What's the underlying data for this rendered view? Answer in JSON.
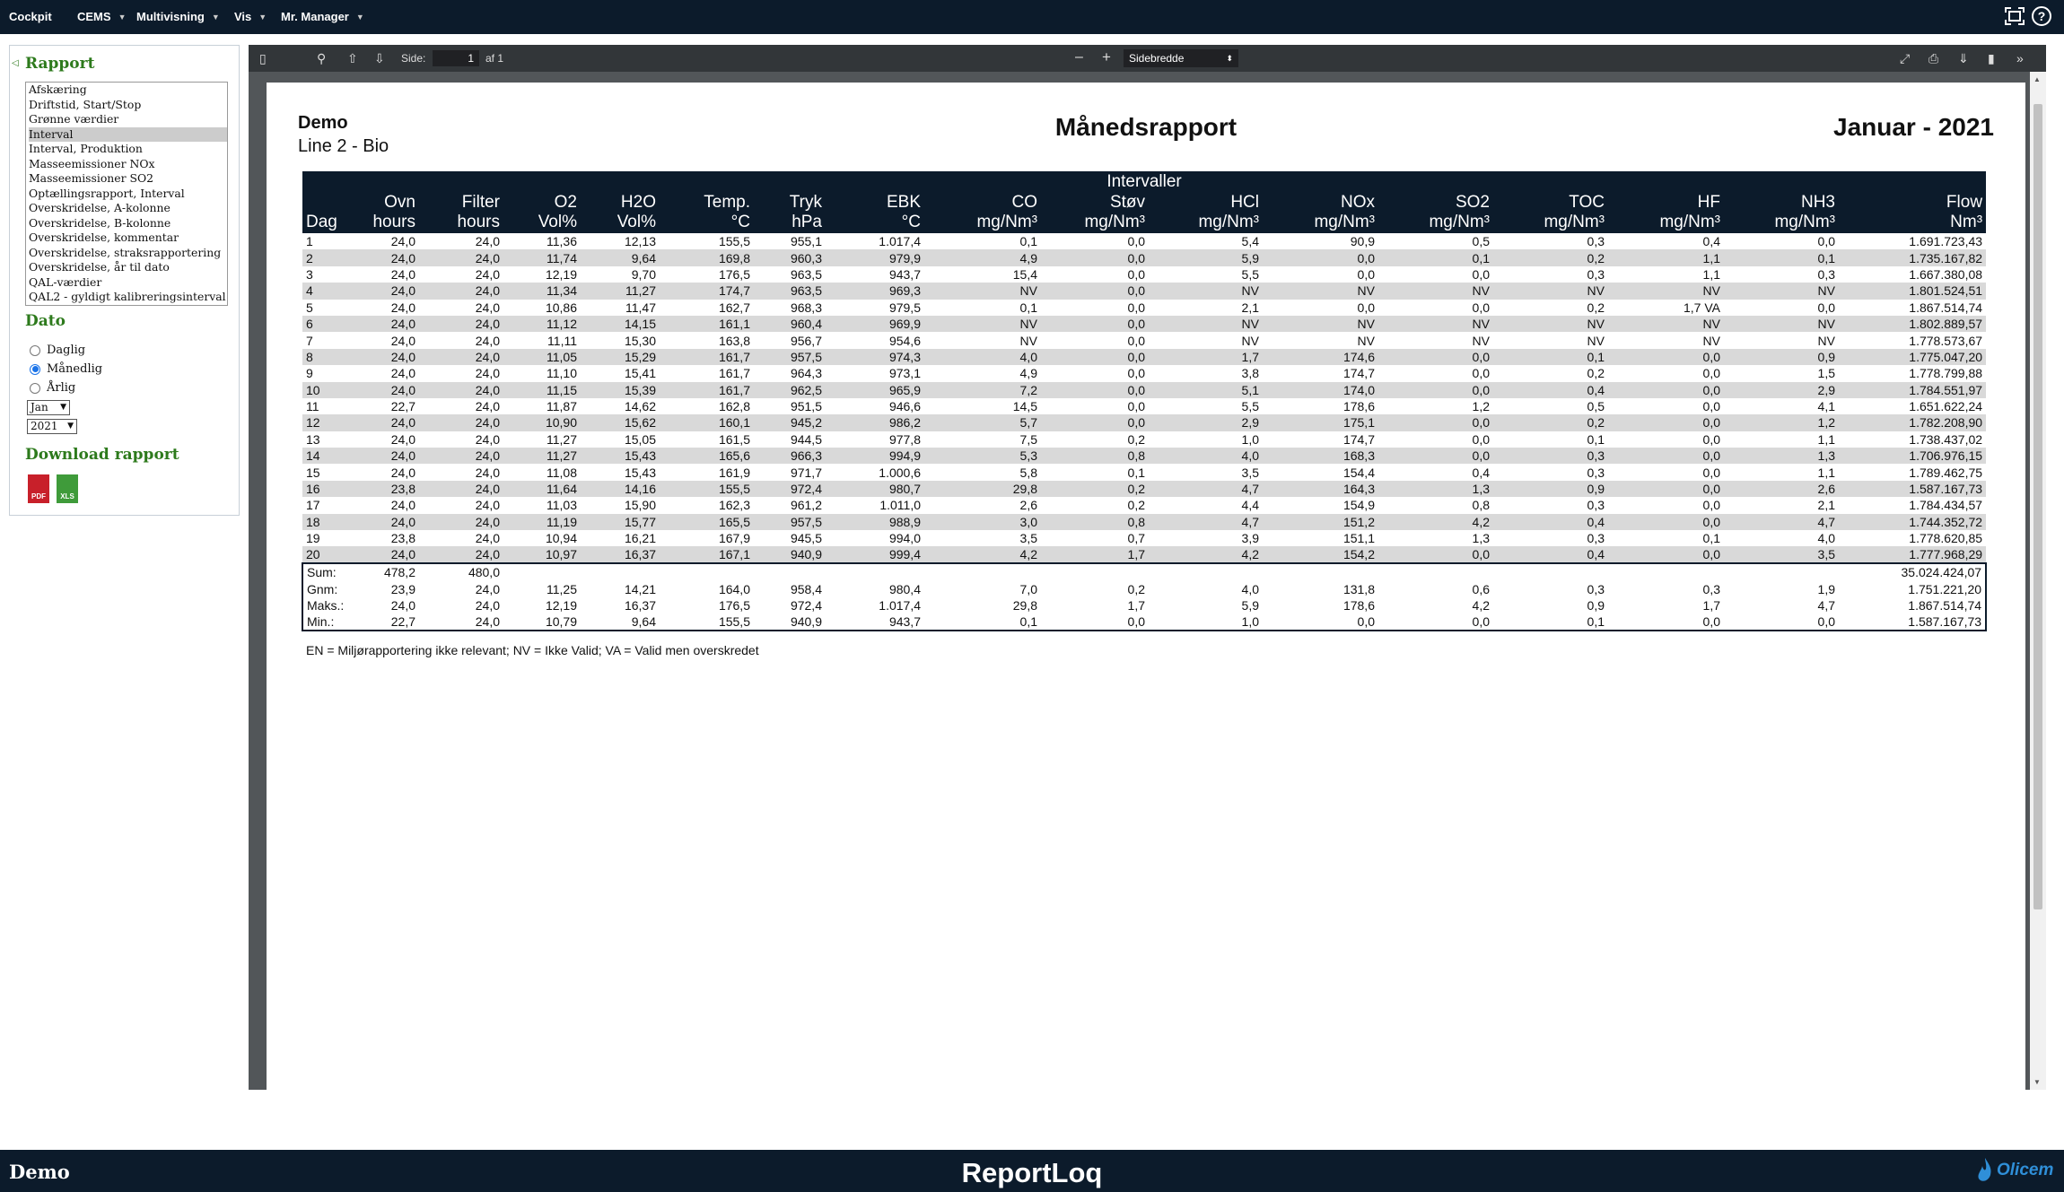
{
  "topbar": {
    "menu": [
      "Cockpit",
      "CEMS",
      "Multivisning",
      "Vis",
      "Mr. Manager"
    ],
    "fullscreen_icon": "fullscreen-icon",
    "help_icon": "help-icon"
  },
  "sidebar": {
    "rapport_title": "Rapport",
    "reports": [
      "Afskæring",
      "Driftstid, Start/Stop",
      "Grønne værdier",
      "Interval",
      "Interval, Produktion",
      "Masseemissioner NOx",
      "Masseemissioner SO2",
      "Optællingsrapport, Interval",
      "Overskridelse, A-kolonne",
      "Overskridelse, B-kolonne",
      "Overskridelse, kommentar",
      "Overskridelse, straksrapportering",
      "Overskridelse, år til dato",
      "QAL-værdier",
      "QAL2 - gyldigt kalibreringsinterval"
    ],
    "selected_report": "Interval",
    "dato_title": "Dato",
    "periods": [
      "Daglig",
      "Månedlig",
      "Årlig"
    ],
    "selected_period": "Månedlig",
    "month": "Jan",
    "year": "2021",
    "download_title": "Download rapport",
    "pdf_label": "PDF",
    "xls_label": "XLS"
  },
  "viewer": {
    "page_label": "Side:",
    "page_value": "1",
    "page_of": "af 1",
    "zoom_out": "–",
    "zoom_in": "+",
    "zoom_mode": "Sidebredde"
  },
  "report": {
    "company": "Demo",
    "line": "Line 2 - Bio",
    "title": "Månedsrapport",
    "period": "Januar - 2021",
    "group_header": "Intervaller",
    "columns": [
      {
        "name": "Dag",
        "unit": ""
      },
      {
        "name": "Ovn",
        "unit": "hours"
      },
      {
        "name": "Filter",
        "unit": "hours"
      },
      {
        "name": "O2",
        "unit": "Vol%"
      },
      {
        "name": "H2O",
        "unit": "Vol%"
      },
      {
        "name": "Temp.",
        "unit": "°C"
      },
      {
        "name": "Tryk",
        "unit": "hPa"
      },
      {
        "name": "EBK",
        "unit": "°C"
      },
      {
        "name": "CO",
        "unit": "mg/Nm³"
      },
      {
        "name": "Støv",
        "unit": "mg/Nm³"
      },
      {
        "name": "HCl",
        "unit": "mg/Nm³"
      },
      {
        "name": "NOx",
        "unit": "mg/Nm³"
      },
      {
        "name": "SO2",
        "unit": "mg/Nm³"
      },
      {
        "name": "TOC",
        "unit": "mg/Nm³"
      },
      {
        "name": "HF",
        "unit": "mg/Nm³"
      },
      {
        "name": "NH3",
        "unit": "mg/Nm³"
      },
      {
        "name": "Flow",
        "unit": "Nm³"
      }
    ],
    "rows": [
      [
        "1",
        "24,0",
        "24,0",
        "11,36",
        "12,13",
        "155,5",
        "955,1",
        "1.017,4",
        "0,1",
        "0,0",
        "5,4",
        "90,9",
        "0,5",
        "0,3",
        "0,4",
        "0,0",
        "1.691.723,43"
      ],
      [
        "2",
        "24,0",
        "24,0",
        "11,74",
        "9,64",
        "169,8",
        "960,3",
        "979,9",
        "4,9",
        "0,0",
        "5,9",
        "0,0",
        "0,1",
        "0,2",
        "1,1",
        "0,1",
        "1.735.167,82"
      ],
      [
        "3",
        "24,0",
        "24,0",
        "12,19",
        "9,70",
        "176,5",
        "963,5",
        "943,7",
        "15,4",
        "0,0",
        "5,5",
        "0,0",
        "0,0",
        "0,3",
        "1,1",
        "0,3",
        "1.667.380,08"
      ],
      [
        "4",
        "24,0",
        "24,0",
        "11,34",
        "11,27",
        "174,7",
        "963,5",
        "969,3",
        "NV",
        "0,0",
        "NV",
        "NV",
        "NV",
        "NV",
        "NV",
        "NV",
        "1.801.524,51"
      ],
      [
        "5",
        "24,0",
        "24,0",
        "10,86",
        "11,47",
        "162,7",
        "968,3",
        "979,5",
        "0,1",
        "0,0",
        "2,1",
        "0,0",
        "0,0",
        "0,2",
        "1,7 VA",
        "0,0",
        "1.867.514,74"
      ],
      [
        "6",
        "24,0",
        "24,0",
        "11,12",
        "14,15",
        "161,1",
        "960,4",
        "969,9",
        "NV",
        "0,0",
        "NV",
        "NV",
        "NV",
        "NV",
        "NV",
        "NV",
        "1.802.889,57"
      ],
      [
        "7",
        "24,0",
        "24,0",
        "11,11",
        "15,30",
        "163,8",
        "956,7",
        "954,6",
        "NV",
        "0,0",
        "NV",
        "NV",
        "NV",
        "NV",
        "NV",
        "NV",
        "1.778.573,67"
      ],
      [
        "8",
        "24,0",
        "24,0",
        "11,05",
        "15,29",
        "161,7",
        "957,5",
        "974,3",
        "4,0",
        "0,0",
        "1,7",
        "174,6",
        "0,0",
        "0,1",
        "0,0",
        "0,9",
        "1.775.047,20"
      ],
      [
        "9",
        "24,0",
        "24,0",
        "11,10",
        "15,41",
        "161,7",
        "964,3",
        "973,1",
        "4,9",
        "0,0",
        "3,8",
        "174,7",
        "0,0",
        "0,2",
        "0,0",
        "1,5",
        "1.778.799,88"
      ],
      [
        "10",
        "24,0",
        "24,0",
        "11,15",
        "15,39",
        "161,7",
        "962,5",
        "965,9",
        "7,2",
        "0,0",
        "5,1",
        "174,0",
        "0,0",
        "0,4",
        "0,0",
        "2,9",
        "1.784.551,97"
      ],
      [
        "11",
        "22,7",
        "24,0",
        "11,87",
        "14,62",
        "162,8",
        "951,5",
        "946,6",
        "14,5",
        "0,0",
        "5,5",
        "178,6",
        "1,2",
        "0,5",
        "0,0",
        "4,1",
        "1.651.622,24"
      ],
      [
        "12",
        "24,0",
        "24,0",
        "10,90",
        "15,62",
        "160,1",
        "945,2",
        "986,2",
        "5,7",
        "0,0",
        "2,9",
        "175,1",
        "0,0",
        "0,2",
        "0,0",
        "1,2",
        "1.782.208,90"
      ],
      [
        "13",
        "24,0",
        "24,0",
        "11,27",
        "15,05",
        "161,5",
        "944,5",
        "977,8",
        "7,5",
        "0,2",
        "1,0",
        "174,7",
        "0,0",
        "0,1",
        "0,0",
        "1,1",
        "1.738.437,02"
      ],
      [
        "14",
        "24,0",
        "24,0",
        "11,27",
        "15,43",
        "165,6",
        "966,3",
        "994,9",
        "5,3",
        "0,8",
        "4,0",
        "168,3",
        "0,0",
        "0,3",
        "0,0",
        "1,3",
        "1.706.976,15"
      ],
      [
        "15",
        "24,0",
        "24,0",
        "11,08",
        "15,43",
        "161,9",
        "971,7",
        "1.000,6",
        "5,8",
        "0,1",
        "3,5",
        "154,4",
        "0,4",
        "0,3",
        "0,0",
        "1,1",
        "1.789.462,75"
      ],
      [
        "16",
        "23,8",
        "24,0",
        "11,64",
        "14,16",
        "155,5",
        "972,4",
        "980,7",
        "29,8",
        "0,2",
        "4,7",
        "164,3",
        "1,3",
        "0,9",
        "0,0",
        "2,6",
        "1.587.167,73"
      ],
      [
        "17",
        "24,0",
        "24,0",
        "11,03",
        "15,90",
        "162,3",
        "961,2",
        "1.011,0",
        "2,6",
        "0,2",
        "4,4",
        "154,9",
        "0,8",
        "0,3",
        "0,0",
        "2,1",
        "1.784.434,57"
      ],
      [
        "18",
        "24,0",
        "24,0",
        "11,19",
        "15,77",
        "165,5",
        "957,5",
        "988,9",
        "3,0",
        "0,8",
        "4,7",
        "151,2",
        "4,2",
        "0,4",
        "0,0",
        "4,7",
        "1.744.352,72"
      ],
      [
        "19",
        "23,8",
        "24,0",
        "10,94",
        "16,21",
        "167,9",
        "945,5",
        "994,0",
        "3,5",
        "0,7",
        "3,9",
        "151,1",
        "1,3",
        "0,3",
        "0,1",
        "4,0",
        "1.778.620,85"
      ],
      [
        "20",
        "24,0",
        "24,0",
        "10,97",
        "16,37",
        "167,1",
        "940,9",
        "999,4",
        "4,2",
        "1,7",
        "4,2",
        "154,2",
        "0,0",
        "0,4",
        "0,0",
        "3,5",
        "1.777.968,29"
      ]
    ],
    "totals": [
      [
        "Sum:",
        "478,2",
        "480,0",
        "",
        "",
        "",
        "",
        "",
        "",
        "",
        "",
        "",
        "",
        "",
        "",
        "",
        "35.024.424,07"
      ],
      [
        "Gnm:",
        "23,9",
        "24,0",
        "11,25",
        "14,21",
        "164,0",
        "958,4",
        "980,4",
        "7,0",
        "0,2",
        "4,0",
        "131,8",
        "0,6",
        "0,3",
        "0,3",
        "1,9",
        "1.751.221,20"
      ],
      [
        "Maks.:",
        "24,0",
        "24,0",
        "12,19",
        "16,37",
        "176,5",
        "972,4",
        "1.017,4",
        "29,8",
        "1,7",
        "5,9",
        "178,6",
        "4,2",
        "0,9",
        "1,7",
        "4,7",
        "1.867.514,74"
      ],
      [
        "Min.:",
        "22,7",
        "24,0",
        "10,79",
        "9,64",
        "155,5",
        "940,9",
        "943,7",
        "0,1",
        "0,0",
        "1,0",
        "0,0",
        "0,0",
        "0,1",
        "0,0",
        "0,0",
        "1.587.167,73"
      ]
    ],
    "legend": "EN = Miljørapportering ikke relevant; NV = Ikke Valid; VA = Valid men overskredet"
  },
  "footer": {
    "left": "Demo",
    "center": "ReportLoq",
    "logo": "Olicem"
  }
}
